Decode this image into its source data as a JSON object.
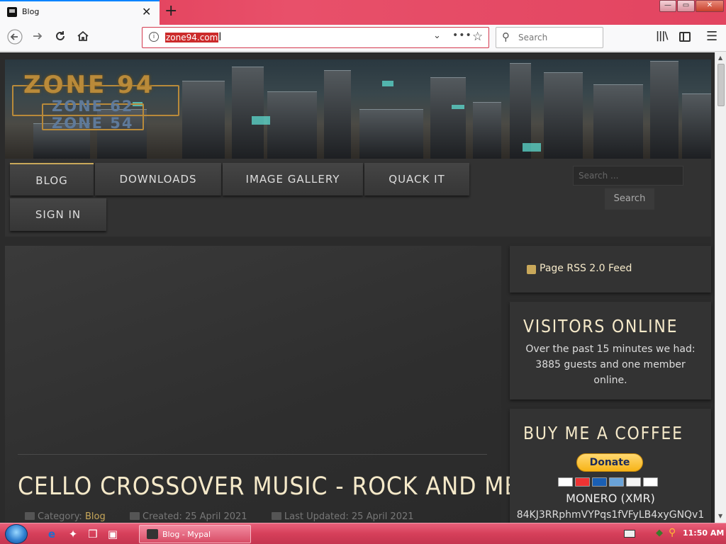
{
  "browser": {
    "tab_title": "Blog",
    "new_tab_symbol": "+",
    "tab_close_symbol": "✕",
    "url": "zone94.com",
    "search_placeholder": "Search",
    "window_buttons": {
      "minimize": "—",
      "maximize": "▭",
      "close": "✕"
    }
  },
  "site": {
    "logo_main": "ZONE 94",
    "logo_sub_1": "ZONE 62",
    "logo_sub_2": "ZONE 54",
    "menu": [
      {
        "label": "BLOG",
        "active": true
      },
      {
        "label": "DOWNLOADS",
        "active": false
      },
      {
        "label": "IMAGE GALLERY",
        "active": false
      },
      {
        "label": "QUACK IT",
        "active": false
      },
      {
        "label": "SIGN IN",
        "active": false
      }
    ],
    "search_placeholder": "Search ...",
    "search_button": "Search"
  },
  "article": {
    "title": "CELLO CROSSOVER MUSIC - ROCK AND METAL",
    "category_label": "Category:",
    "category": "Blog",
    "created": "Created: 25 April 2021",
    "updated": "Last Updated: 25 April 2021"
  },
  "sidebar": {
    "rss_label": "Page RSS 2.0 Feed",
    "visitors_title": "VISITORS ONLINE",
    "visitors_text": "Over the past 15 minutes we had: 3885 guests and one member online.",
    "coffee_title": "BUY ME A COFFEE",
    "donate_label": "Donate",
    "monero_label": "MONERO (XMR)",
    "xmr_address": "84KJ3RRphmVYPqs1fVFyLB4xyGNQv1"
  },
  "taskbar": {
    "active_task": "Blog - Mypal",
    "clock": "11:50 AM"
  },
  "colors": {
    "accent_gold": "#c9a85a",
    "title_cream": "#f5e9c9",
    "taskbar_pink": "#d63f5a"
  }
}
